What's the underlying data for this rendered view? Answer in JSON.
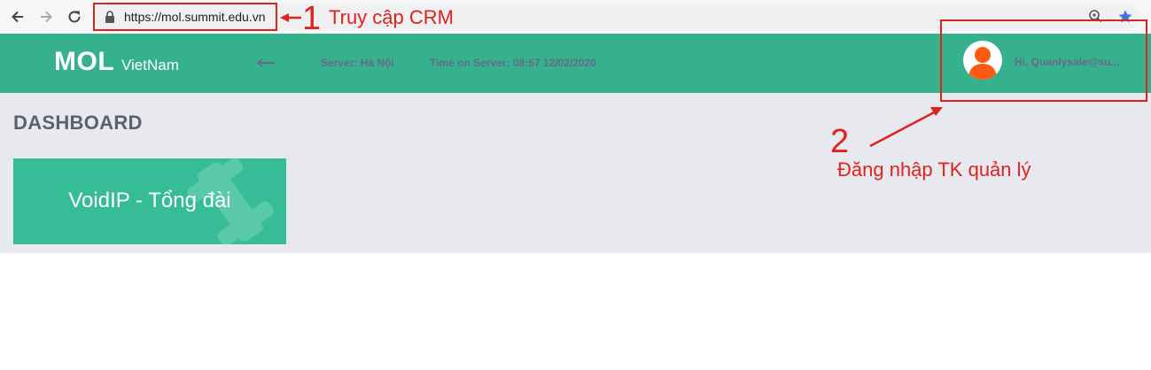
{
  "browser": {
    "url": "https://mol.summit.edu.vn",
    "icons": [
      "back-arrow-icon",
      "forward-arrow-icon",
      "reload-icon",
      "lock-icon",
      "zoom-icon",
      "star-icon"
    ]
  },
  "header": {
    "logo_main": "MOL",
    "logo_sub": "VietNam",
    "server": "Server: Hà Nội",
    "time_on_server": "Time on Server: 08:57 12/02/2020",
    "greeting": "Hi, Quanlysale@su..."
  },
  "dashboard": {
    "title": "DASHBOARD",
    "tiles": [
      {
        "label": "VoidIP - Tổng đài"
      }
    ]
  },
  "annotations": {
    "step1_number": "1",
    "step1_text": "Truy cập CRM",
    "step2_number": "2",
    "step2_text": "Đăng nhập TK quản lý",
    "color": "#e0211d"
  },
  "colors": {
    "header_green": "#36b18e",
    "tile_green": "#36bd98",
    "avatar_orange": "#ff5a13"
  }
}
